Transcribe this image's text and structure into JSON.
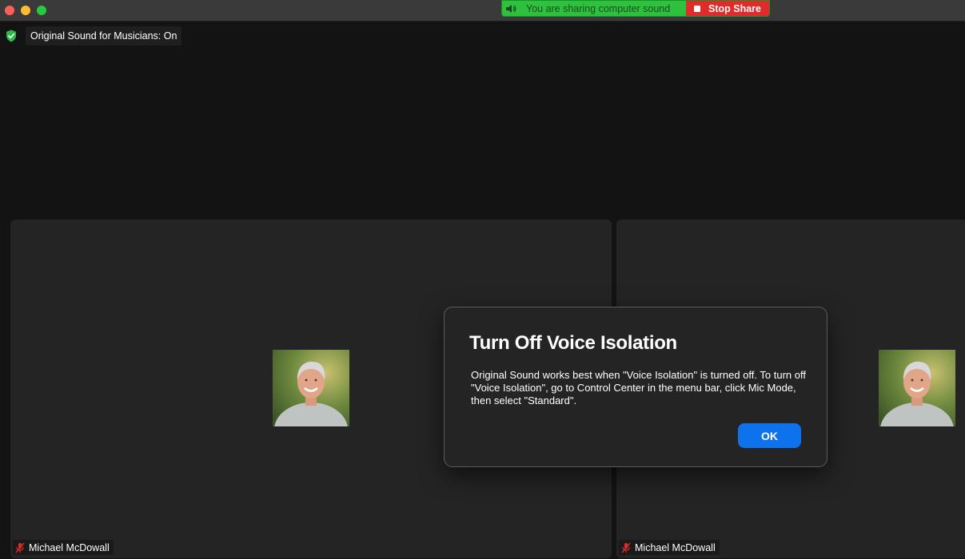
{
  "window": {
    "controls": [
      "close",
      "minimize",
      "zoom"
    ]
  },
  "share_bar": {
    "status_text": "You are sharing computer sound",
    "stop_label": "Stop Share",
    "status_color": "#2ec13e",
    "stop_color": "#e02b2b",
    "speaker_icon": "speaker-icon",
    "stop_icon": "stop-square-icon"
  },
  "original_sound": {
    "label": "Original Sound for Musicians: On",
    "icon": "shield-check-icon"
  },
  "participants": [
    {
      "name": "Michael McDowall",
      "muted": true,
      "mic_icon": "mic-muted-icon"
    },
    {
      "name": "Michael McDowall",
      "muted": true,
      "mic_icon": "mic-muted-icon"
    }
  ],
  "dialog": {
    "title": "Turn Off Voice Isolation",
    "body": "Original Sound works best when \"Voice Isolation\" is turned off. To turn off \"Voice Isolation\", go to Control Center in the menu bar, click Mic Mode, then select \"Standard\".",
    "ok_label": "OK",
    "ok_color": "#0e72ed"
  }
}
